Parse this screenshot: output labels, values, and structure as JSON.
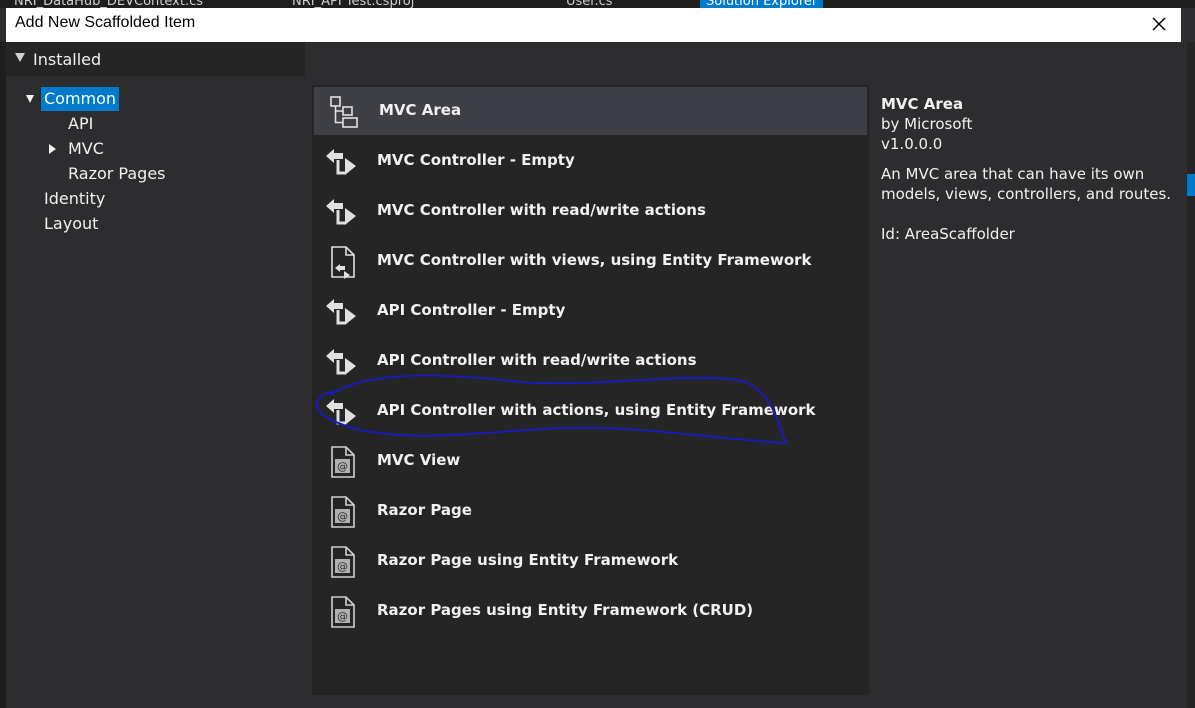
{
  "dialog": {
    "title": "Add New Scaffolded Item",
    "close_icon": "close-icon"
  },
  "background": {
    "tabs": [
      "NRI_DataHub_DEVContext.cs",
      "NRI_API Test.csproj",
      "User.cs",
      "Solution Explorer"
    ]
  },
  "tree": {
    "root_label": "Installed",
    "items": [
      {
        "label": "Common",
        "selected": true,
        "expanded": true
      },
      {
        "label": "API"
      },
      {
        "label": "MVC",
        "collapsed_children": true
      },
      {
        "label": "Razor Pages"
      },
      {
        "label": "Identity"
      },
      {
        "label": "Layout"
      }
    ]
  },
  "templates": [
    {
      "label": "MVC Area",
      "icon": "area-icon",
      "selected": true
    },
    {
      "label": "MVC Controller - Empty",
      "icon": "controller-icon"
    },
    {
      "label": "MVC Controller with read/write actions",
      "icon": "controller-icon"
    },
    {
      "label": "MVC Controller with views, using Entity Framework",
      "icon": "page-controller-icon"
    },
    {
      "label": "API Controller - Empty",
      "icon": "controller-icon"
    },
    {
      "label": "API Controller with read/write actions",
      "icon": "controller-icon"
    },
    {
      "label": "API Controller with actions, using Entity Framework",
      "icon": "controller-icon",
      "highlighted": true
    },
    {
      "label": "MVC View",
      "icon": "razor-page-icon"
    },
    {
      "label": "Razor Page",
      "icon": "razor-page-icon"
    },
    {
      "label": "Razor Page using Entity Framework",
      "icon": "razor-page-icon"
    },
    {
      "label": "Razor Pages using Entity Framework (CRUD)",
      "icon": "razor-page-icon"
    }
  ],
  "details": {
    "name": "MVC Area",
    "author": "by Microsoft",
    "version": "v1.0.0.0",
    "description": "An MVC area that can have its own models, views, controllers, and routes.",
    "id": "Id: AreaScaffolder"
  },
  "annotation_color": "#1a1ab8"
}
